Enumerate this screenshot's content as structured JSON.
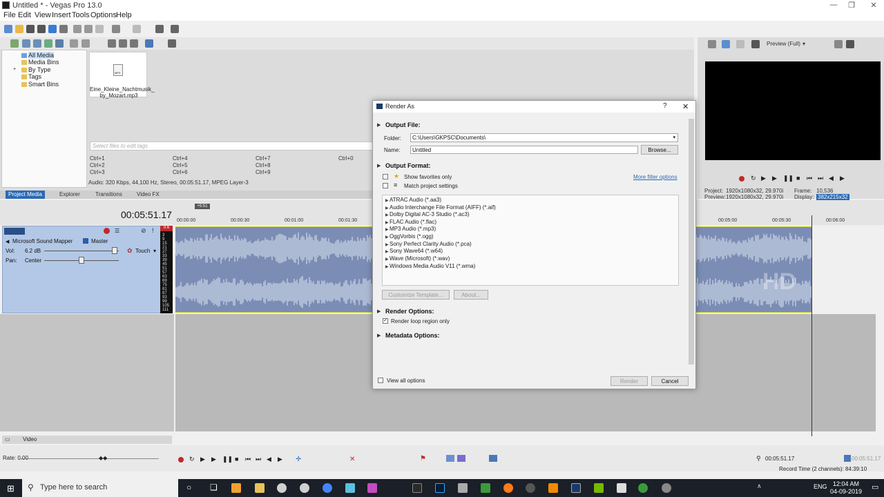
{
  "window": {
    "title": "Untitled * - Vegas Pro 13.0",
    "controls": [
      "—",
      "❐",
      "✕"
    ]
  },
  "menu": [
    "File",
    "Edit",
    "View",
    "Insert",
    "Tools",
    "Options",
    "Help"
  ],
  "media_tree": [
    "All Media",
    "Media Bins",
    "By Type",
    "Tags",
    "Smart Bins"
  ],
  "media_file": {
    "name_line1": "Eine_Kleine_Nachtmusik_",
    "name_line2": "by_Mozart.mp3",
    "badge": "MP3"
  },
  "tags_placeholder": "Select files to edit tags",
  "shortcuts": [
    [
      "Ctrl+1",
      "Ctrl+4",
      "Ctrl+7",
      "Ctrl+0"
    ],
    [
      "Ctrl+2",
      "Ctrl+5",
      "Ctrl+8",
      ""
    ],
    [
      "Ctrl+3",
      "Ctrl+6",
      "Ctrl+9",
      ""
    ]
  ],
  "media_status": "Audio: 320 Kbps, 44,100 Hz, Stereo, 00:05:51.17, MPEG Layer-3",
  "tabs": [
    "Project Media",
    "Explorer",
    "Transitions",
    "Video FX"
  ],
  "preview": {
    "mode": "Preview (Full)",
    "project_label": "Project:",
    "project_value": "1920x1080x32, 29.970i",
    "preview_label": "Preview:",
    "preview_value": "1920x1080x32, 29.970i",
    "frame_label": "Frame:",
    "frame_value": "10,536",
    "display_label": "Display:",
    "display_value": "382x215x32"
  },
  "timeline": {
    "timecode": "00:05:51.17",
    "marker": "+5:51",
    "ruler": [
      "00:00:00",
      "00:00:30",
      "00:01:00",
      "00:01:30",
      "00:05:00",
      "00:05:30",
      "00:06:00"
    ],
    "track": {
      "device": "Microsoft Sound Mapper",
      "bus": "Master",
      "vol_label": "Vol:",
      "vol_value": "6.2 dB",
      "pan_label": "Pan:",
      "pan_value": "Center",
      "automation": "Touch"
    },
    "meter_peak": "0.6",
    "meter_scale": [
      "3",
      "9",
      "15",
      "21",
      "27",
      "33",
      "39",
      "45",
      "51",
      "57",
      "63",
      "69",
      "75",
      "81",
      "87",
      "93",
      "99",
      "105",
      "111",
      "117"
    ],
    "video_bus": "Video",
    "rate": "Rate: 0.00",
    "end_time": "00:05:51.17",
    "end_time2": "00:05:51.17",
    "record_time": "Record Time (2 channels): 84:39:10"
  },
  "dialog": {
    "title": "Render As",
    "help": "?",
    "close": "✕",
    "output_file": "Output File:",
    "folder_label": "Folder:",
    "folder_value": "C:\\Users\\GKPSC\\Documents\\",
    "name_label": "Name:",
    "name_value": "Untitled",
    "browse": "Browse...",
    "output_format": "Output Format:",
    "show_favorites": "Show favorites only",
    "match_project": "Match project settings",
    "more_filter": "More filter options",
    "formats": [
      "ATRAC Audio (*.aa3)",
      "Audio Interchange File Format (AIFF) (*.aif)",
      "Dolby Digital AC-3 Studio (*.ac3)",
      "FLAC Audio (*.flac)",
      "MP3 Audio (*.mp3)",
      "OggVorbis (*.ogg)",
      "Sony Perfect Clarity Audio (*.pca)",
      "Sony Wave64 (*.w64)",
      "Wave (Microsoft) (*.wav)",
      "Windows Media Audio V11 (*.wma)"
    ],
    "customize_template": "Customize Template...",
    "about": "About...",
    "render_options": "Render Options:",
    "render_loop": "Render loop region only",
    "metadata_options": "Metadata Options:",
    "view_all": "View all options",
    "render": "Render",
    "cancel": "Cancel"
  },
  "taskbar": {
    "search_placeholder": "Type here to search",
    "lang": "ENG",
    "time": "12:04 AM",
    "date": "04-09-2019"
  },
  "colors": {
    "accent": "#2b6ab5",
    "waveform_bg": "#7b8db4",
    "waveform": "#dfe6f2",
    "track_header": "#b3c8e6",
    "link": "#2b6ab5"
  }
}
